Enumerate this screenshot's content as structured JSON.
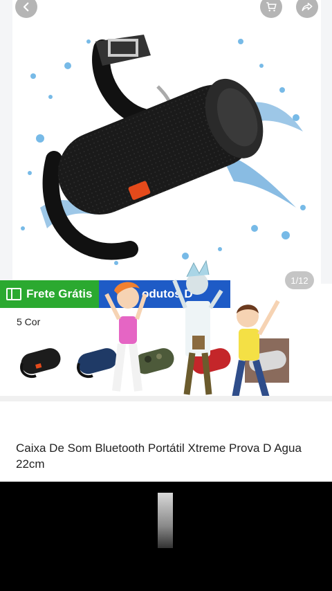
{
  "header": {
    "back_icon": "back-arrow-icon",
    "cart_icon": "cart-icon",
    "share_icon": "share-icon"
  },
  "gallery": {
    "counter": "1/12"
  },
  "banner": {
    "free_shipping": "Frete Grátis",
    "products_label": "odutos D"
  },
  "colors": {
    "label": "5 Cor",
    "swatches": [
      "black-orange",
      "blue",
      "camouflage",
      "red",
      "gray"
    ]
  },
  "product": {
    "title": "Caixa De Som Bluetooth Portátil Xtreme Prova D Agua 22cm"
  },
  "colors_theme": {
    "green": "#2ba930",
    "blue": "#1e5bc6"
  }
}
